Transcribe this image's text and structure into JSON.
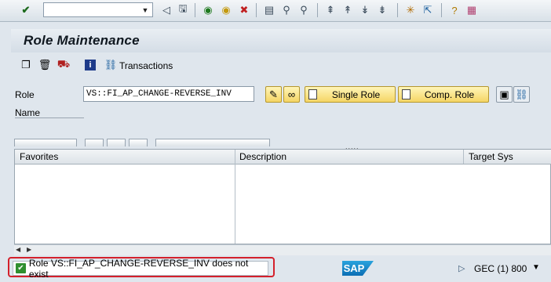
{
  "toolbar": {
    "command_value": "",
    "icons": [
      "enter-icon",
      "back-icon",
      "save-icon",
      "navigate-back-icon",
      "exit-icon",
      "cancel-icon",
      "print-icon",
      "find-icon",
      "find-next-icon",
      "first-page-icon",
      "prev-page-icon",
      "next-page-icon",
      "last-page-icon",
      "new-session-icon",
      "shortcut-icon",
      "help-icon",
      "layout-icon"
    ]
  },
  "title": "Role Maintenance",
  "app_toolbar": {
    "transactions_label": "Transactions"
  },
  "form": {
    "role_label": "Role",
    "role_value": "VS::FI_AP_CHANGE-REVERSE_INV",
    "name_label": "Name"
  },
  "buttons": {
    "single_role": "Single Role",
    "comp_role": "Comp. Role"
  },
  "grip": ".....",
  "table": {
    "columns": [
      "Favorites",
      "Description",
      "Target Sys"
    ]
  },
  "status": {
    "message": "Role VS::FI_AP_CHANGE-REVERSE_INV does not exist",
    "logo": "SAP",
    "system": "GEC (1) 800"
  },
  "colors": {
    "status_highlight": "#d4202b",
    "button_yellow": "#f5d565",
    "sap_blue": "#0c6eb4"
  }
}
